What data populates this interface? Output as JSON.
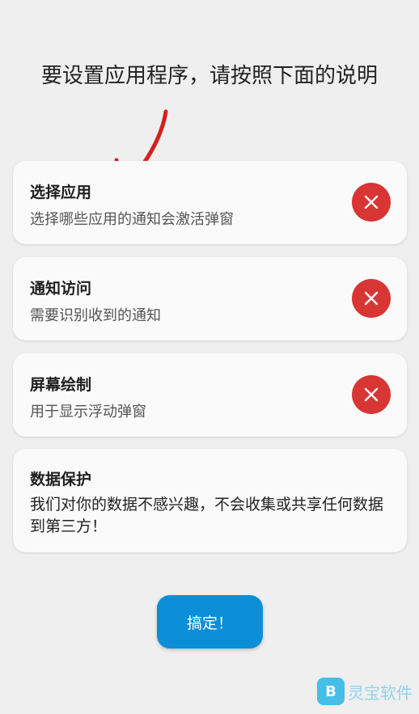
{
  "header": {
    "title": "要设置应用程序，请按照下面的说明"
  },
  "cards": [
    {
      "title": "选择应用",
      "description": "选择哪些应用的通知会激活弹窗",
      "status": "not-granted",
      "status_icon": "close-icon"
    },
    {
      "title": "通知访问",
      "description": "需要识别收到的通知",
      "status": "not-granted",
      "status_icon": "close-icon"
    },
    {
      "title": "屏幕绘制",
      "description": "用于显示浮动弹窗",
      "status": "not-granted",
      "status_icon": "close-icon"
    },
    {
      "title": "数据保护",
      "description": "我们对你的数据不感兴趣，不会收集或共享任何数据到第三方！"
    }
  ],
  "done_button": {
    "label": "搞定！"
  },
  "watermark": {
    "text": "灵宝软件"
  },
  "colors": {
    "background": "#efefef",
    "card": "#fafafa",
    "status_error": "#d83535",
    "primary": "#0a8fd6",
    "annotation_arrow": "#d42020"
  }
}
